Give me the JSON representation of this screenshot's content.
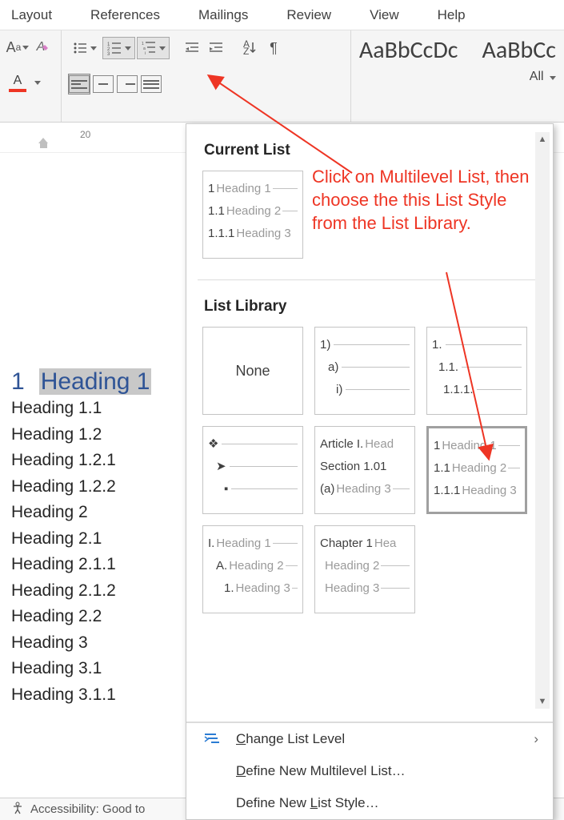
{
  "ribbon": {
    "tabs": [
      "Layout",
      "References",
      "Mailings",
      "Review",
      "View",
      "Help"
    ]
  },
  "styles": {
    "sample1": "AaBbCcDc",
    "sample2": "AaBbCc",
    "all_label": "All"
  },
  "ruler": {
    "label": "20"
  },
  "document": {
    "heading_number": "1",
    "heading_text": "Heading 1",
    "lines": [
      "Heading 1.1",
      "Heading 1.2",
      "Heading 1.2.1",
      "Heading 1.2.2",
      "Heading 2",
      "Heading 2.1",
      "Heading 2.1.1",
      "Heading 2.1.2",
      "Heading 2.2",
      "Heading 3",
      "Heading 3.1",
      "Heading 3.1.1"
    ]
  },
  "dropdown": {
    "current_title": "Current List",
    "library_title": "List Library",
    "none_label": "None",
    "current_thumb": {
      "l1": {
        "num": "1",
        "lbl": "Heading 1"
      },
      "l2": {
        "num": "1.1",
        "lbl": "Heading 2"
      },
      "l3": {
        "num": "1.1.1",
        "lbl": "Heading 3"
      }
    },
    "lib_thumbs": {
      "t2": {
        "l1": "1)",
        "l2": "a)",
        "l3": "i)"
      },
      "t3": {
        "l1": "1.",
        "l2": "1.1.",
        "l3": "1.1.1."
      },
      "t5": {
        "l1a": "Article I.",
        "l1b": "Head",
        "l2a": "Section 1.01",
        "l3a": "(a)",
        "l3b": "Heading 3"
      },
      "t6": {
        "l1": {
          "num": "1",
          "lbl": "Heading 1"
        },
        "l2": {
          "num": "1.1",
          "lbl": "Heading 2"
        },
        "l3": {
          "num": "1.1.1",
          "lbl": "Heading 3"
        }
      },
      "t7": {
        "l1": {
          "num": "I.",
          "lbl": "Heading 1"
        },
        "l2": {
          "num": "A.",
          "lbl": "Heading 2"
        },
        "l3": {
          "num": "1.",
          "lbl": "Heading 3"
        }
      },
      "t8": {
        "l1a": "Chapter 1",
        "l1b": "Hea",
        "l2": "Heading 2",
        "l3": "Heading 3"
      }
    },
    "menu": {
      "change_level": "Change List Level",
      "define_multi": "Define New Multilevel List…",
      "define_style": "Define New List Style…"
    }
  },
  "annotation": {
    "text": "Click on Multilevel List, then choose the this List Style from the List Library."
  },
  "statusbar": {
    "text": "Accessibility: Good to"
  }
}
